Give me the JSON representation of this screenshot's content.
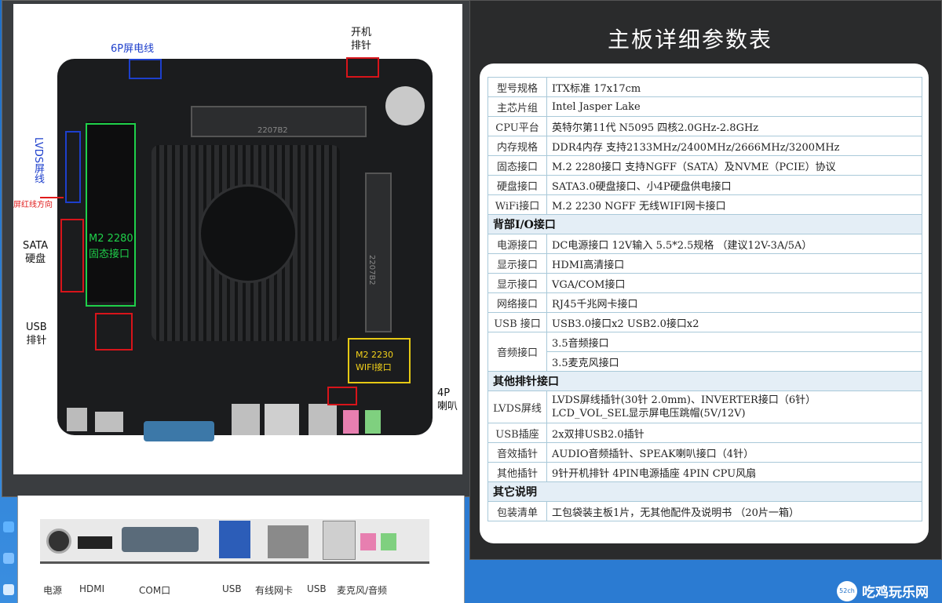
{
  "left_image": {
    "labels": {
      "lvds_header": "LVDS屏线",
      "red_line_direction": "屏红线方向",
      "sata_hdd": "SATA\n硬盘",
      "usb_header": "USB\n排针",
      "six_pin_screen": "6P屏电线",
      "power_header": "开机\n排针",
      "m2_2280": "M2 2280\n固态接口",
      "m2_2230": "M2 2230\nWIFI接口",
      "speaker_4p": "4P\n喇叭",
      "chip_mark_1": "2207B2",
      "chip_mark_2": "2207B2"
    },
    "rear_io_labels": [
      "电源",
      "HDMI",
      "COM口",
      "USB",
      "有线网卡",
      "USB",
      "麦克风/音频"
    ]
  },
  "spec_panel": {
    "title": "主板详细参数表",
    "rows": [
      {
        "key": "型号规格",
        "value": "ITX标准  17x17cm"
      },
      {
        "key": "主芯片组",
        "value": "Intel Jasper Lake"
      },
      {
        "key": "CPU平台",
        "value": "英特尔第11代 N5095 四核2.0GHz-2.8GHz"
      },
      {
        "key": "内存规格",
        "value": "DDR4内存 支持2133MHz/2400MHz/2666MHz/3200MHz"
      },
      {
        "key": "固态接口",
        "value": "M.2 2280接口 支持NGFF（SATA）及NVME（PCIE）协议"
      },
      {
        "key": "硬盘接口",
        "value": "SATA3.0硬盘接口、小4P硬盘供电接口"
      },
      {
        "key": "WiFi接口",
        "value": "M.2 2230 NGFF 无线WIFI网卡接口"
      }
    ],
    "section_io": "背部I/O接口",
    "io_rows": [
      {
        "key": "电源接口",
        "value": "DC电源接口 12V输入 5.5*2.5规格  （建议12V-3A/5A）"
      },
      {
        "key": "显示接口",
        "value": "HDMI高清接口"
      },
      {
        "key": "显示接口",
        "value": "VGA/COM接口"
      },
      {
        "key": "网络接口",
        "value": "RJ45千兆网卡接口"
      },
      {
        "key": "USB 接口",
        "value": "USB3.0接口x2  USB2.0接口x2"
      }
    ],
    "audio": {
      "key": "音频接口",
      "values": [
        "3.5音频接口",
        "3.5麦克风接口"
      ]
    },
    "section_other_headers": "其他排针接口",
    "header_rows": [
      {
        "key": "LVDS屏线",
        "value": "LVDS屏线插针(30针 2.0mm)、INVERTER接口（6针）\nLCD_VOL_SEL显示屏电压跳帽(5V/12V)"
      },
      {
        "key": "USB插座",
        "value": "2x双排USB2.0插针"
      },
      {
        "key": "音效插针",
        "value": "AUDIO音频插针、SPEAK喇叭接口（4针）"
      },
      {
        "key": "其他插针",
        "value": "9针开机排针 4PIN电源插座  4PIN CPU风扇"
      }
    ],
    "section_notes": "其它说明",
    "note_rows": [
      {
        "key": "包装清单",
        "value": "工包袋装主板1片，无其他配件及说明书 （20片一箱）"
      }
    ]
  },
  "watermark": {
    "text": "吃鸡玩乐网",
    "badge": "52ch"
  },
  "colors": {
    "desktop": "#2b7bd2",
    "section_bg": "#e4eef6",
    "border": "#a9c9d9"
  }
}
